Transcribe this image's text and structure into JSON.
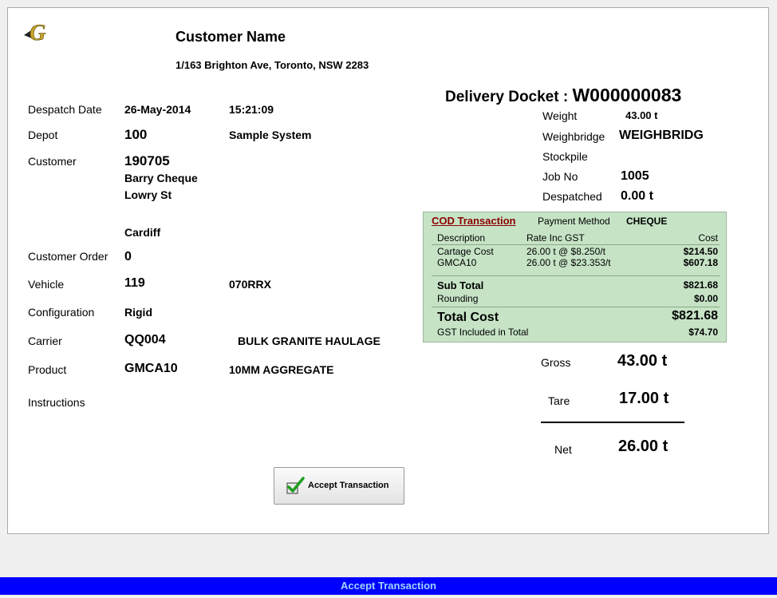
{
  "header": {
    "logo_letter": "G",
    "customer_name": "Customer Name",
    "address": "1/163 Brighton Ave, Toronto, NSW  2283"
  },
  "fields": {
    "despatch_date_label": "Despatch Date",
    "despatch_date": "26-May-2014",
    "despatch_time": "15:21:09",
    "depot_label": "Depot",
    "depot": "100",
    "depot_name": "Sample System",
    "customer_label": "Customer",
    "customer_code": "190705",
    "customer_line1": "Barry Cheque",
    "customer_line2": "Lowry St",
    "customer_line3": "Cardiff",
    "customer_order_label": "Customer Order",
    "customer_order": "0",
    "vehicle_label": "Vehicle",
    "vehicle": "119",
    "vehicle_rego": "070RRX",
    "configuration_label": "Configuration",
    "configuration": "Rigid",
    "carrier_label": "Carrier",
    "carrier": "QQ004",
    "carrier_name": "BULK GRANITE HAULAGE",
    "product_label": "Product",
    "product": "GMCA10",
    "product_name": "10MM AGGREGATE",
    "instructions_label": "Instructions"
  },
  "docket": {
    "title": "Delivery Docket : ",
    "number": "W000000083",
    "weight_label": "Weight",
    "weight": "43.00 t",
    "weighbridge_label": "Weighbridge",
    "weighbridge": "WEIGHBRIDG",
    "stockpile_label": "Stockpile",
    "job_label": "Job No",
    "job": "1005",
    "despatched_label": "Despatched",
    "despatched": "0.00 t"
  },
  "cod": {
    "title": "COD Transaction",
    "payment_method_label": "Payment Method",
    "payment_method": "CHEQUE",
    "col_description": "Description",
    "col_rate": "Rate Inc GST",
    "col_cost": "Cost",
    "rows": [
      {
        "description": "Cartage Cost",
        "rate": "26.00 t @ $8.250/t",
        "cost": "$214.50"
      },
      {
        "description": "GMCA10",
        "rate": "26.00 t @ $23.353/t",
        "cost": "$607.18"
      }
    ],
    "sub_total_label": "Sub Total",
    "sub_total": "$821.68",
    "rounding_label": "Rounding",
    "rounding": "$0.00",
    "total_cost_label": "Total Cost",
    "total_cost": "$821.68",
    "gst_label": "GST Included in Total",
    "gst": "$74.70"
  },
  "weights": {
    "gross_label": "Gross",
    "gross": "43.00 t",
    "tare_label": "Tare",
    "tare": "17.00 t",
    "net_label": "Net",
    "net": "26.00 t"
  },
  "actions": {
    "accept_label": "Accept Transaction"
  },
  "status_bar": {
    "text": "Accept Transaction"
  },
  "colors": {
    "cod_background": "#c6e3c6",
    "cod_title": "#8b0000",
    "status_bar": "#0000ff",
    "status_text": "#9ed6ff"
  }
}
